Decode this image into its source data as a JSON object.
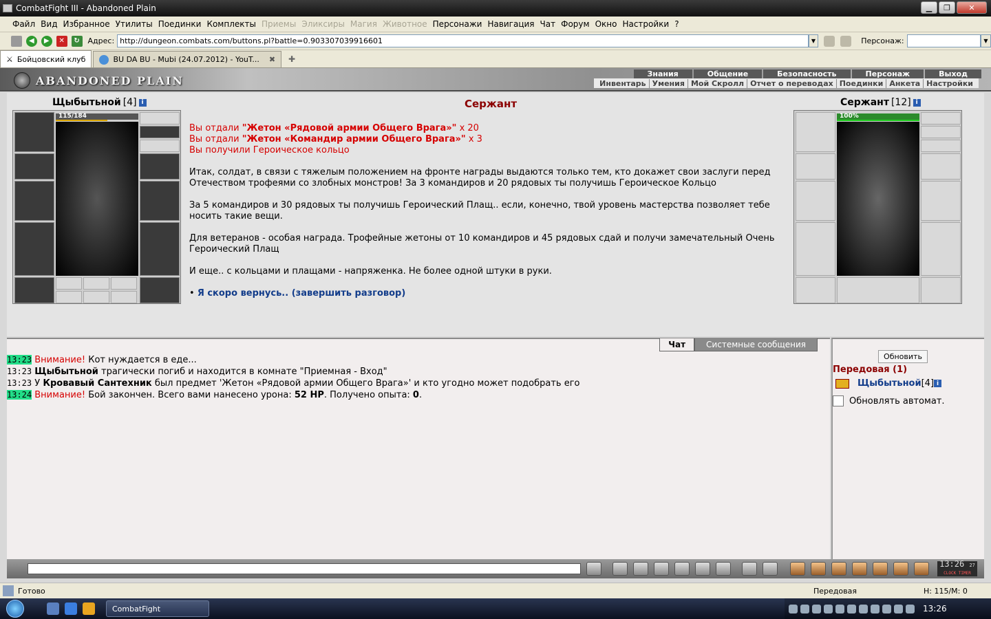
{
  "window": {
    "title": "CombatFight III - Abandoned Plain",
    "minimize": "▁",
    "maximize": "❐",
    "close": "✕"
  },
  "menu": {
    "items": [
      {
        "label": "Файл",
        "disabled": false
      },
      {
        "label": "Вид",
        "disabled": false
      },
      {
        "label": "Избранное",
        "disabled": false
      },
      {
        "label": "Утилиты",
        "disabled": false
      },
      {
        "label": "Поединки",
        "disabled": false
      },
      {
        "label": "Комплекты",
        "disabled": false
      },
      {
        "label": "Приемы",
        "disabled": true
      },
      {
        "label": "Эликсиры",
        "disabled": true
      },
      {
        "label": "Магия",
        "disabled": true
      },
      {
        "label": "Животное",
        "disabled": true
      },
      {
        "label": "Персонажи",
        "disabled": false
      },
      {
        "label": "Навигация",
        "disabled": false
      },
      {
        "label": "Чат",
        "disabled": false
      },
      {
        "label": "Форум",
        "disabled": false
      },
      {
        "label": "Окно",
        "disabled": false
      },
      {
        "label": "Настройки",
        "disabled": false
      },
      {
        "label": "?",
        "disabled": false
      }
    ]
  },
  "address": {
    "label": "Адрес:",
    "url": "http://dungeon.combats.com/buttons.pl?battle=0.903307039916601",
    "character_label": "Персонаж:"
  },
  "tabs": [
    {
      "label": "Бойцовский клуб",
      "active": true
    },
    {
      "label": "BU DA BU - Mubi (24.07.2012) - YouT...",
      "active": false
    }
  ],
  "game": {
    "logo": "ABANDONED PLAIN",
    "topnav": [
      "Знания",
      "Общение",
      "Безопасность",
      "Персонаж",
      "Выход"
    ],
    "subnav": [
      "Инвентарь",
      "Умения",
      "Мой Скролл",
      "Отчет о переводах",
      "Поединки",
      "Анкета",
      "Настройки"
    ]
  },
  "player": {
    "name": "Щыбытьной",
    "level": "[4]",
    "hp_text": "115/184",
    "hp_fraction": 0.625
  },
  "npc": {
    "name": "Сержант",
    "level": "[12]",
    "hp_text": "100%",
    "hp_fraction": 1.0
  },
  "dialog": {
    "title": "Сержант",
    "gave_prefix": "Вы отдали",
    "item1": "\"Жетон «Рядовой армии Общего Врага»\"",
    "item1_count": "x 20",
    "item2": "\"Жетон «Командир армии Общего Врага»\"",
    "item2_count": "x 3",
    "received": "Вы получили Героическое кольцо",
    "p1": "Итак, солдат, в связи с тяжелым положением на фронте награды выдаются только тем, кто докажет свои заслуги перед Отечеством трофеями со злобных монстров! За 3 командиров и 20 рядовых ты получишь Героическое Кольцо",
    "p2": "За 5 командиров и 30 рядовых ты получишь Героический Плащ.. если, конечно, твой уровень мастерства позволяет тебе носить такие вещи.",
    "p3": "Для ветеранов - особая награда. Трофейные жетоны от 10 командиров и 45 рядовых сдай и получи замечательный Очень Героический Плащ",
    "p4": "И еще.. с кольцами и плащами - напряженка. Не более одной штуки в руки.",
    "bullet": "•",
    "exit_link": "Я скоро вернусь.. (завершить разговор)"
  },
  "chat": {
    "tab_chat": "Чат",
    "tab_system": "Системные сообщения",
    "lines": [
      {
        "time": "13:23",
        "highlight": true,
        "warn": "Внимание!",
        "bold": "",
        "text": "Кот нуждается в еде...",
        "bold2": "",
        "text2": "",
        "bold3": "",
        "text3": ""
      },
      {
        "time": "13:23",
        "highlight": false,
        "warn": "",
        "bold": "Щыбытьной",
        "text": " трагически погиб и находится в комнате \"Приемная - Вход\"",
        "bold2": "",
        "text2": "",
        "bold3": "",
        "text3": ""
      },
      {
        "time": "13:23",
        "highlight": false,
        "warn": "",
        "bold": "",
        "text": "У ",
        "bold2": "Кровавый Сантехник",
        "text2": " был предмет 'Жетон «Рядовой армии Общего Врага»' и кто угодно может подобрать его",
        "bold3": "",
        "text3": ""
      },
      {
        "time": "13:24",
        "highlight": true,
        "warn": "Внимание!",
        "bold": "",
        "text": " Бой закончен. Всего вами нанесено урона: ",
        "bold2": "52 HP",
        "text2": ". Получено опыта: ",
        "bold3": "0",
        "text3": "."
      }
    ]
  },
  "side": {
    "refresh": "Обновить",
    "room": "Передовая (1)",
    "user_name": "Щыбытьной",
    "user_level": "[4]",
    "auto_label": "Обновлять автомат."
  },
  "clock": {
    "time": "13:26",
    "sec": "27",
    "labels": "CLOCK  TIMER"
  },
  "status": {
    "left": "Готово",
    "zone": "Передовая",
    "hp": "Н: 115/М: 0"
  },
  "taskbar": {
    "task": "CombatFight",
    "time": "13:26"
  },
  "colors": {
    "accent_red": "#d60000",
    "npc_title": "#8b0000",
    "link_blue": "#123c8a",
    "time_highlight": "#22dd88"
  }
}
